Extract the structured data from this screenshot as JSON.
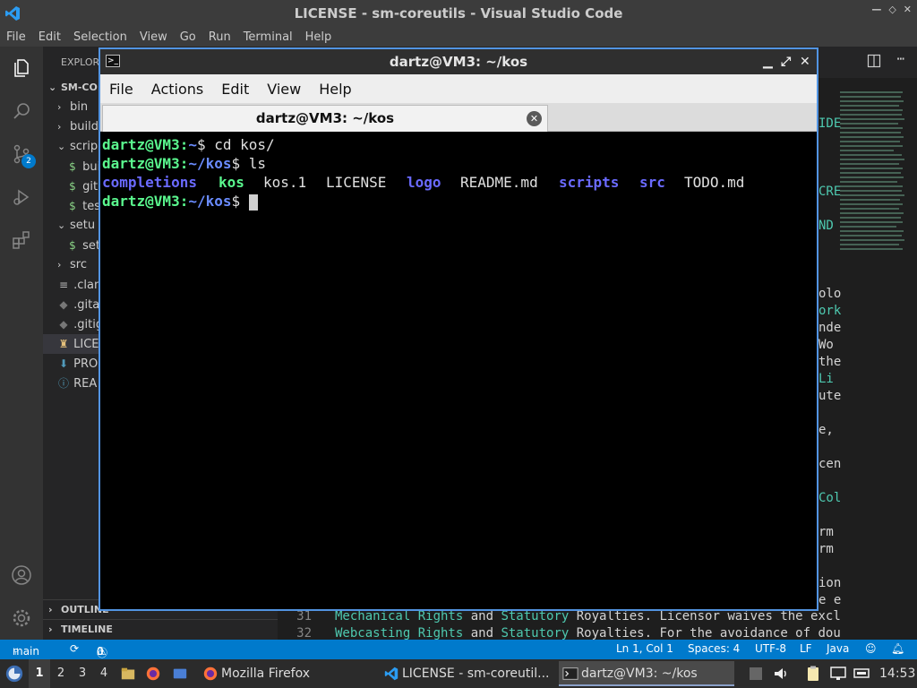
{
  "vscode": {
    "title": "LICENSE - sm-coreutils - Visual Studio Code",
    "menu": [
      "File",
      "Edit",
      "Selection",
      "View",
      "Go",
      "Run",
      "Terminal",
      "Help"
    ],
    "scm_badge": "2",
    "sidebar": {
      "header": "EXPLOR",
      "items": [
        {
          "label": "SM-CO",
          "icon": ""
        },
        {
          "label": "bin",
          "icon": ""
        },
        {
          "label": "build",
          "icon": ""
        },
        {
          "label": "scrip",
          "icon": ""
        },
        {
          "label": "buil",
          "icon": "$"
        },
        {
          "label": "git.",
          "icon": "$"
        },
        {
          "label": "tes",
          "icon": "$"
        },
        {
          "label": "setu",
          "icon": ""
        },
        {
          "label": "set",
          "icon": "$"
        },
        {
          "label": "src",
          "icon": ""
        },
        {
          "label": ".clan",
          "icon": "≡"
        },
        {
          "label": ".gita",
          "icon": "◆"
        },
        {
          "label": ".gitig",
          "icon": "◆"
        },
        {
          "label": "LICE",
          "icon": "♜"
        },
        {
          "label": "PRO",
          "icon": "⬇"
        },
        {
          "label": "REA",
          "icon": "ⓘ"
        }
      ],
      "outline": "OUTLINE",
      "timeline": "TIMELINE"
    },
    "editor": {
      "fragments": [
        {
          "text": "IDE",
          "color": "#4ec9b0"
        },
        {
          "text": "CRE",
          "color": "#4ec9b0"
        },
        {
          "text": "ND",
          "color": "#4ec9b0"
        },
        {
          "text": "olo",
          "color": "#d4d4d4"
        },
        {
          "text": "ork",
          "color": "#4ec9b0"
        },
        {
          "text": "nde",
          "color": "#d4d4d4"
        },
        {
          "text": " Wo",
          "color": "#d4d4d4"
        },
        {
          "text": "the",
          "color": "#d4d4d4"
        },
        {
          "text": " Li",
          "color": "#4ec9b0"
        },
        {
          "text": "ute",
          "color": "#d4d4d4"
        },
        {
          "text": "e,",
          "color": "#d4d4d4"
        },
        {
          "text": "cen",
          "color": "#d4d4d4"
        },
        {
          "text": "Col",
          "color": "#4ec9b0"
        },
        {
          "text": "rm",
          "color": "#d4d4d4"
        },
        {
          "text": "rm",
          "color": "#d4d4d4"
        },
        {
          "text": "ion",
          "color": "#d4d4d4"
        },
        {
          "text": "e e",
          "color": "#d4d4d4"
        }
      ],
      "lines": [
        {
          "num": "31",
          "parts": [
            {
              "t": "Mechanical Rights",
              "c": "t-teal"
            },
            {
              "t": " and ",
              "c": "t-txt"
            },
            {
              "t": "Statutory",
              "c": "t-teal"
            },
            {
              "t": " Royalties. Licensor waives the excl",
              "c": "t-txt"
            }
          ]
        },
        {
          "num": "32",
          "parts": [
            {
              "t": "Webcasting Rights",
              "c": "t-teal"
            },
            {
              "t": " and ",
              "c": "t-txt"
            },
            {
              "t": "Statutory",
              "c": "t-teal"
            },
            {
              "t": " Royalties. For the avoidance of dou",
              "c": "t-txt"
            }
          ]
        }
      ]
    },
    "status": {
      "branch": "main",
      "errors": "0",
      "warnings": "0",
      "position": "Ln 1, Col 1",
      "spaces": "Spaces: 4",
      "encoding": "UTF-8",
      "eol": "LF",
      "language": "Java"
    }
  },
  "terminal": {
    "window_title": "dartz@VM3: ~/kos",
    "menu": [
      "File",
      "Actions",
      "Edit",
      "View",
      "Help"
    ],
    "tab_title": "dartz@VM3: ~/kos",
    "lines": [
      {
        "user": "dartz@VM3",
        "path": "~",
        "cmd": "cd kos/"
      },
      {
        "user": "dartz@VM3",
        "path": "~/kos",
        "cmd": "ls"
      }
    ],
    "ls_output": [
      {
        "name": "completions",
        "type": "dir"
      },
      {
        "name": "kos",
        "type": "exe"
      },
      {
        "name": "kos.1",
        "type": "file"
      },
      {
        "name": "LICENSE",
        "type": "file"
      },
      {
        "name": "logo",
        "type": "dir"
      },
      {
        "name": "README.md",
        "type": "file"
      },
      {
        "name": "scripts",
        "type": "dir"
      },
      {
        "name": "src",
        "type": "dir"
      },
      {
        "name": "TODO.md",
        "type": "file"
      }
    ],
    "prompt": {
      "user": "dartz@VM3",
      "path": "~/kos"
    }
  },
  "taskbar": {
    "workspaces": [
      "1",
      "2",
      "3",
      "4"
    ],
    "tasks": [
      {
        "label": "Mozilla Firefox",
        "icon": "firefox-icon"
      },
      {
        "label": "LICENSE - sm-coreutil...",
        "icon": "vscode-icon"
      },
      {
        "label": "dartz@VM3: ~/kos",
        "icon": "terminal-icon"
      }
    ],
    "clock": "14:53"
  }
}
